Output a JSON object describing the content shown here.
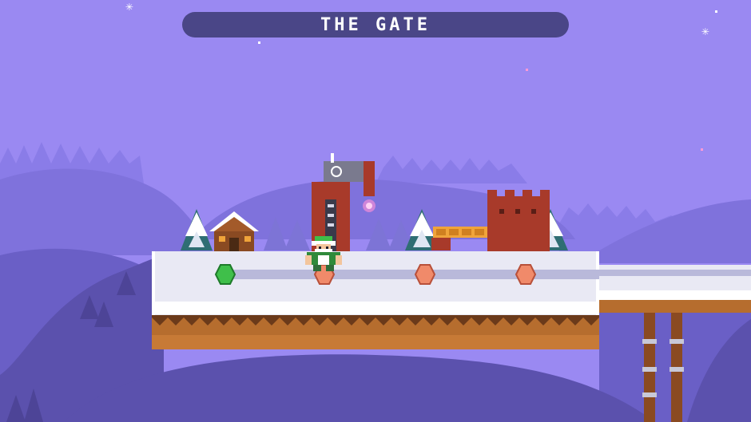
{
  "level": {
    "title": "THE GATE"
  },
  "colors": {
    "sky": "#9a89f2",
    "far_hills": "#7f72dc",
    "mid_hills": "#6a5fc6",
    "near_hills": "#5b51ad",
    "snow": "#e9e9f4",
    "path": "#b9b9da",
    "dirt": "#b66d2e",
    "dirt_dark": "#6b3a1a",
    "brick": "#a83a2a",
    "title_bar": "#4a4687",
    "node_completed": "#3fbf4a",
    "node_locked": "#f08a6a"
  },
  "icons": {
    "player": "elf-player-icon",
    "completed_node": "green-diamond-icon",
    "locked_node": "orange-diamond-icon",
    "gate": "gate-tower-icon",
    "castle": "castle-icon",
    "cabin": "cabin-icon"
  },
  "map": {
    "level_nodes": [
      {
        "name": "level-node-1",
        "state": "completed"
      },
      {
        "name": "level-node-2",
        "state": "current"
      },
      {
        "name": "level-node-3",
        "state": "locked"
      },
      {
        "name": "level-node-4",
        "state": "locked"
      }
    ]
  }
}
